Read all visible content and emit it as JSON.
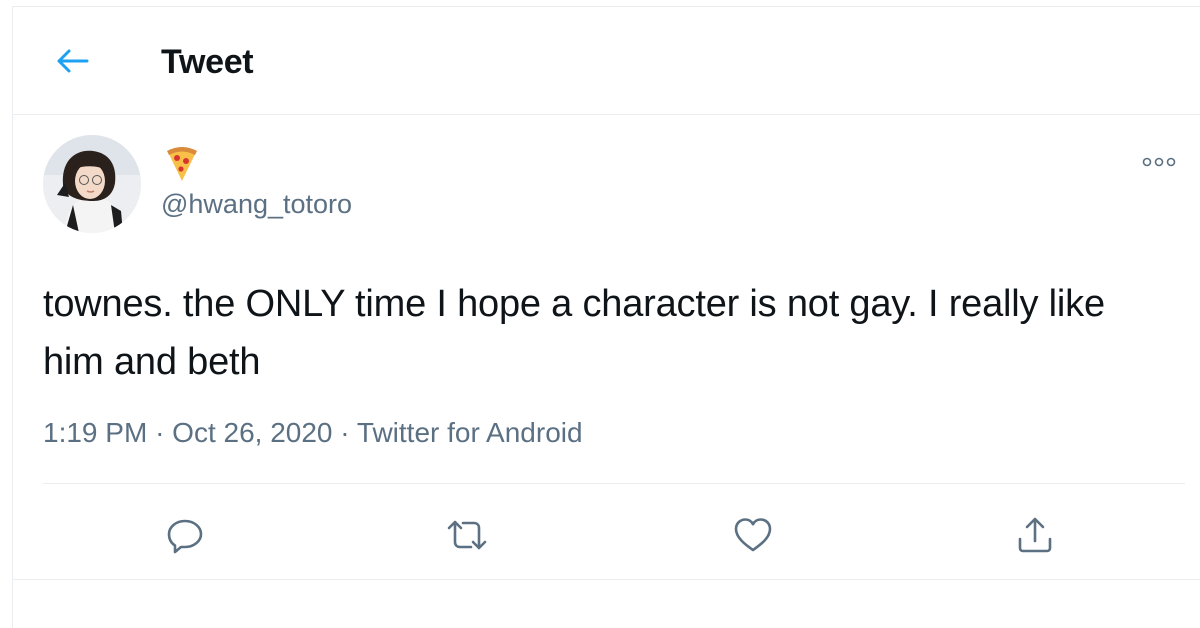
{
  "header": {
    "title": "Tweet",
    "back_icon": "arrow-left-icon"
  },
  "tweet": {
    "display_name_emoji": "🍕",
    "handle": "@hwang_totoro",
    "text": "townes. the ONLY time I hope a character is not gay. I really like him and beth",
    "time": "1:19 PM",
    "date": "Oct 26, 2020",
    "separator": "·",
    "source": "Twitter for Android"
  },
  "actions": {
    "reply_icon": "reply-icon",
    "retweet_icon": "retweet-icon",
    "like_icon": "heart-icon",
    "share_icon": "share-icon",
    "more_icon": "more-options-icon"
  },
  "colors": {
    "accent": "#1da1f2",
    "secondary_text": "#5b7083",
    "border": "#ebeef0",
    "icon": "#5b7083"
  }
}
